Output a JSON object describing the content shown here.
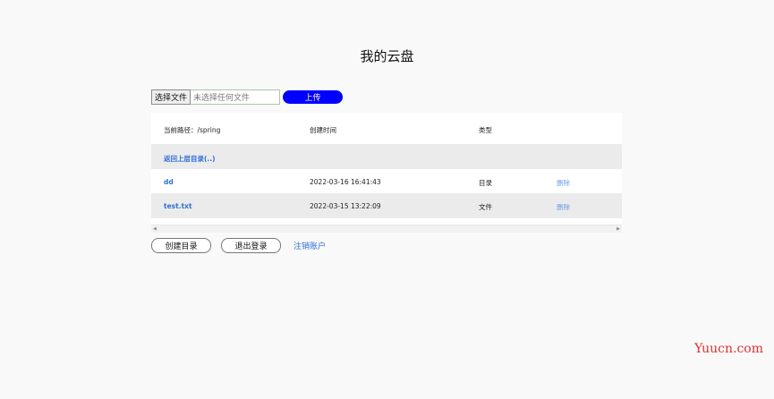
{
  "page": {
    "title": "我的云盘"
  },
  "upload": {
    "choose_label": "选择文件",
    "no_file_label": "未选择任何文件",
    "upload_label": "上传",
    "accent": "#0000ff"
  },
  "table": {
    "path_label": "当前路径：/spring",
    "headers": {
      "time": "创建时间",
      "type": "类型"
    },
    "parent_link": "返回上层目录(..)",
    "rows": [
      {
        "name": "dd",
        "time": "2022-03-16 16:41:43",
        "type": "目录",
        "action": "删除"
      },
      {
        "name": "test.txt",
        "time": "2022-03-15 13:22:09",
        "type": "文件",
        "action": "删除"
      }
    ]
  },
  "actions": {
    "create_dir": "创建目录",
    "logout": "退出登录",
    "delete_account": "注销账户"
  },
  "watermark": "Yuucn.com"
}
